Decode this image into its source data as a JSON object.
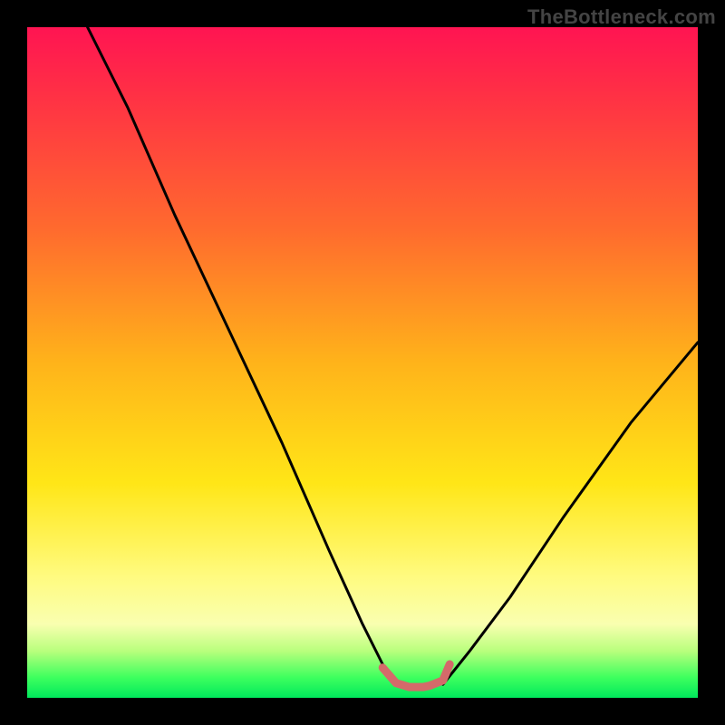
{
  "watermark": "TheBottleneck.com",
  "chart_data": {
    "type": "line",
    "title": "",
    "xlabel": "",
    "ylabel": "",
    "xlim": [
      0,
      100
    ],
    "ylim": [
      0,
      100
    ],
    "notes": "Bottleneck-style curve: two black arcs descending from the upper corners to a flat trough near x≈55–62%, y≈2%. A short salmon segment marks the trough. Background is a vertical heat gradient (red top → green bottom). No axis ticks or numeric labels are visible.",
    "series": [
      {
        "name": "left-curve",
        "color": "#000000",
        "x": [
          9,
          15,
          22,
          30,
          38,
          45,
          50,
          53,
          55
        ],
        "y": [
          100,
          88,
          72,
          55,
          38,
          22,
          11,
          5,
          2
        ]
      },
      {
        "name": "right-curve",
        "color": "#000000",
        "x": [
          62,
          66,
          72,
          80,
          90,
          100
        ],
        "y": [
          2,
          7,
          15,
          27,
          41,
          53
        ]
      },
      {
        "name": "trough-highlight",
        "color": "#d46a6a",
        "x": [
          53,
          55,
          57,
          59,
          60,
          62,
          63
        ],
        "y": [
          4.5,
          2.2,
          1.6,
          1.6,
          1.8,
          2.6,
          5
        ]
      }
    ],
    "gradient_stops": [
      {
        "pos": 0,
        "color": "#ff1452"
      },
      {
        "pos": 10,
        "color": "#ff3045"
      },
      {
        "pos": 30,
        "color": "#ff6a2e"
      },
      {
        "pos": 50,
        "color": "#ffb31a"
      },
      {
        "pos": 68,
        "color": "#ffe617"
      },
      {
        "pos": 82,
        "color": "#fffb80"
      },
      {
        "pos": 89,
        "color": "#f9ffb0"
      },
      {
        "pos": 93,
        "color": "#b9ff7d"
      },
      {
        "pos": 97,
        "color": "#3dff5e"
      },
      {
        "pos": 100,
        "color": "#00e85c"
      }
    ]
  }
}
